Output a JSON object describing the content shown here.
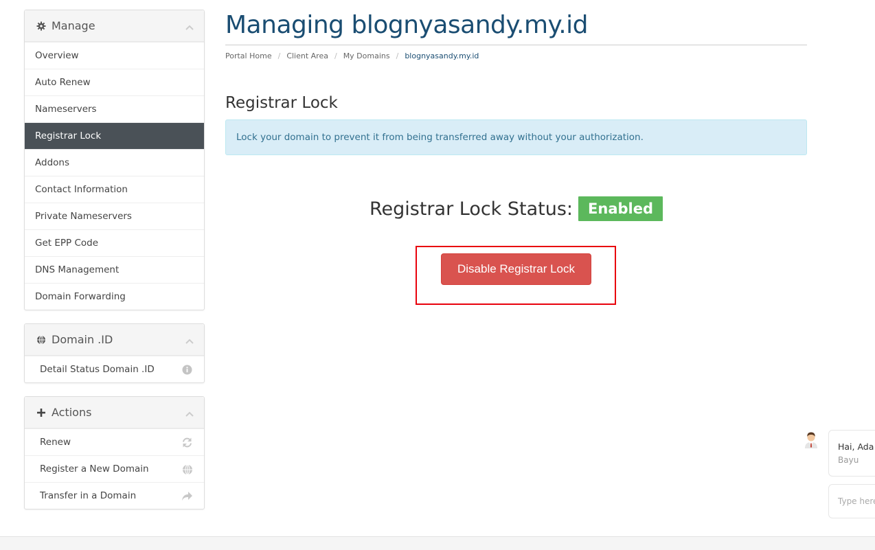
{
  "sidebar": {
    "manage": {
      "title": "Manage",
      "items": [
        {
          "label": "Overview"
        },
        {
          "label": "Auto Renew"
        },
        {
          "label": "Nameservers"
        },
        {
          "label": "Registrar Lock"
        },
        {
          "label": "Addons"
        },
        {
          "label": "Contact Information"
        },
        {
          "label": "Private Nameservers"
        },
        {
          "label": "Get EPP Code"
        },
        {
          "label": "DNS Management"
        },
        {
          "label": "Domain Forwarding"
        }
      ],
      "active_index": 3
    },
    "domain_id": {
      "title": "Domain .ID",
      "items": [
        {
          "label": "Detail Status Domain .ID",
          "icon": "info-circle-icon"
        }
      ]
    },
    "actions": {
      "title": "Actions",
      "items": [
        {
          "label": "Renew",
          "icon": "refresh-icon"
        },
        {
          "label": "Register a New Domain",
          "icon": "globe-icon"
        },
        {
          "label": "Transfer in a Domain",
          "icon": "share-arrow-icon"
        }
      ]
    }
  },
  "main": {
    "title": "Managing blognyasandy.my.id",
    "breadcrumb": [
      "Portal Home",
      "Client Area",
      "My Domains",
      "blognyasandy.my.id"
    ],
    "section_title": "Registrar Lock",
    "alert_text": "Lock your domain to prevent it from being transferred away without your authorization.",
    "status_label": "Registrar Lock Status:",
    "status_value": "Enabled",
    "disable_button": "Disable Registrar Lock"
  },
  "chat": {
    "message": "Hai, Ada y",
    "agent": "Bayu",
    "input_placeholder": "Type here"
  },
  "colors": {
    "title": "#1a4d72",
    "active_menu": "#4a5157",
    "alert_bg": "#d9edf7",
    "status_enabled": "#5cb85c",
    "danger": "#d9534f",
    "highlight": "#e8000b"
  }
}
